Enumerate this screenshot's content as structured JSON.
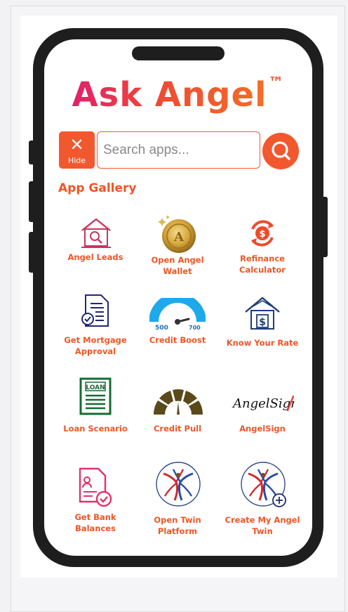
{
  "app": {
    "title": "Ask Angel",
    "trademark": "TM"
  },
  "search": {
    "hide_label": "Hide",
    "placeholder": "Search apps...",
    "value": ""
  },
  "gallery": {
    "heading": "App Gallery",
    "apps": [
      {
        "label": "Angel Leads",
        "icon": "house-search-icon"
      },
      {
        "label": "Open Angel Wallet",
        "icon": "gold-coin-icon"
      },
      {
        "label": "Refinance Calculator",
        "icon": "dollar-refresh-icon"
      },
      {
        "label": "Get Mortgage Approval",
        "icon": "document-check-icon"
      },
      {
        "label": "Credit Boost",
        "icon": "credit-gauge-icon",
        "gauge_min": "500",
        "gauge_max": "700"
      },
      {
        "label": "Know Your Rate",
        "icon": "house-dollar-icon"
      },
      {
        "label": "Loan Scenario",
        "icon": "loan-document-icon",
        "icon_text": "LOAN"
      },
      {
        "label": "Credit Pull",
        "icon": "dial-gauge-icon"
      },
      {
        "label": "AngelSign",
        "icon": "angelsign-logo-icon",
        "icon_text": "AngelSign"
      },
      {
        "label": "Get Bank Balances",
        "icon": "person-document-check-icon"
      },
      {
        "label": "Open Twin Platform",
        "icon": "dancers-icon"
      },
      {
        "label": "Create My Angel Twin",
        "icon": "dancers-plus-icon"
      }
    ]
  },
  "colors": {
    "accent": "#f2582e",
    "heading": "#ef5524",
    "phone_body": "#1e1e1e"
  }
}
